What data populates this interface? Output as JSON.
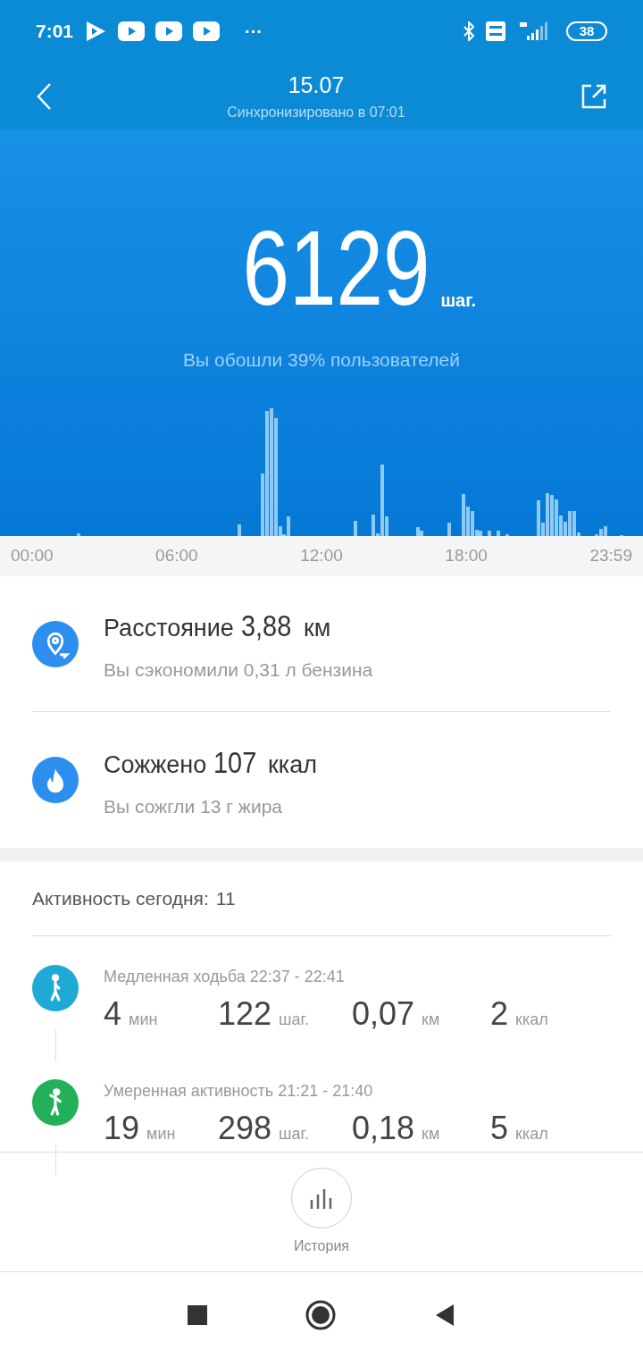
{
  "status_bar": {
    "time": "7:01",
    "more": "···",
    "battery": "38"
  },
  "header": {
    "date": "15.07",
    "sync": "Синхронизировано в 07:01"
  },
  "hero": {
    "steps": "6129",
    "unit": "шаг.",
    "compare": "Вы обошли 39% пользователей"
  },
  "axis_labels": [
    "00:00",
    "06:00",
    "12:00",
    "18:00",
    "23:59"
  ],
  "summary": [
    {
      "kind": "distance",
      "label": "Расстояние",
      "value": "3,88",
      "unit": "км",
      "note": "Вы сэкономили 0,31 л бензина"
    },
    {
      "kind": "calories",
      "label": "Сожжено",
      "value": "107",
      "unit": "ккал",
      "note": "Вы сожгли 13 г жира"
    }
  ],
  "activity": {
    "title": "Активность сегодня:",
    "count": "11",
    "items": [
      {
        "kind": "walk",
        "color": "#1eaad4",
        "title": "Медленная ходьба 22:37 - 22:41",
        "stats": [
          {
            "value": "4",
            "unit": "мин"
          },
          {
            "value": "122",
            "unit": "шаг."
          },
          {
            "value": "0,07",
            "unit": "км"
          },
          {
            "value": "2",
            "unit": "ккал"
          }
        ]
      },
      {
        "kind": "moderate",
        "color": "#22b15a",
        "title": "Умеренная активность 21:21 - 21:40",
        "stats": [
          {
            "value": "19",
            "unit": "мин"
          },
          {
            "value": "298",
            "unit": "шаг."
          },
          {
            "value": "0,18",
            "unit": "км"
          },
          {
            "value": "5",
            "unit": "ккал"
          }
        ]
      }
    ]
  },
  "bottom": {
    "history": "История"
  }
}
